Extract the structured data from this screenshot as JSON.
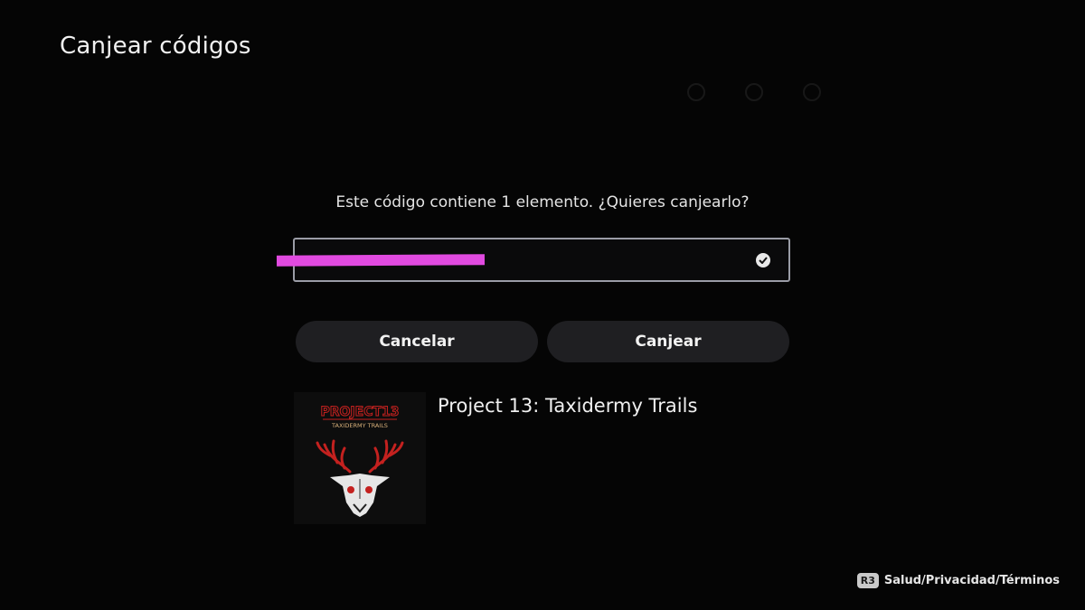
{
  "header": {
    "title": "Canjear códigos"
  },
  "dialog": {
    "prompt": "Este código contiene 1 elemento. ¿Quieres canjearlo?",
    "code_value": "",
    "cancel_label": "Cancelar",
    "redeem_label": "Canjear"
  },
  "item": {
    "title": "Project 13: Taxidermy Trails",
    "art_logo_text": "PROJECT13",
    "art_subtitle_text": "TAXIDERMY TRAILS"
  },
  "footer": {
    "badge": "R3",
    "link_label": "Salud/Privacidad/Términos"
  },
  "colors": {
    "background": "#050505",
    "button_bg": "#1f1f22",
    "field_border": "#9a9ca6",
    "redaction": "#e14ae0",
    "art_red": "#c4211f"
  }
}
